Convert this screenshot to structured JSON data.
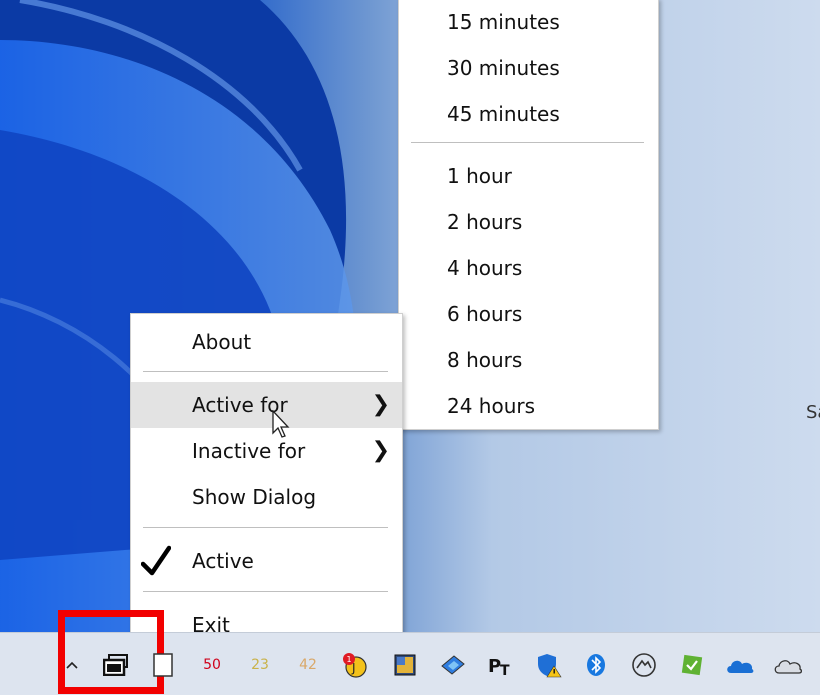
{
  "main_menu": {
    "items": [
      {
        "label": "About"
      },
      {
        "label": "Active for"
      },
      {
        "label": "Inactive for"
      },
      {
        "label": "Show Dialog"
      },
      {
        "label": "Active"
      },
      {
        "label": "Exit"
      }
    ]
  },
  "submenu": {
    "minutes": [
      "15 minutes",
      "30 minutes",
      "45 minutes"
    ],
    "hours": [
      "1 hour",
      "2 hours",
      "4 hours",
      "6 hours",
      "8 hours",
      "24 hours"
    ]
  },
  "tray": {
    "counters": [
      "50",
      "23",
      "42"
    ],
    "counter_colors": [
      "#d0021b",
      "#c9b24a",
      "#d9a86a"
    ],
    "edge_text": "Sa"
  },
  "colors": {
    "highlight": "#e3e3e3",
    "red_box": "#f20000"
  },
  "icons": [
    "chevron-up-icon",
    "display-icon",
    "window-icon",
    "notes-icon",
    "app-icon",
    "photos-icon",
    "powertoys-icon",
    "security-shield-icon",
    "bluetooth-icon",
    "performance-icon",
    "check-app-icon",
    "onedrive-icon",
    "cloud-icon"
  ]
}
